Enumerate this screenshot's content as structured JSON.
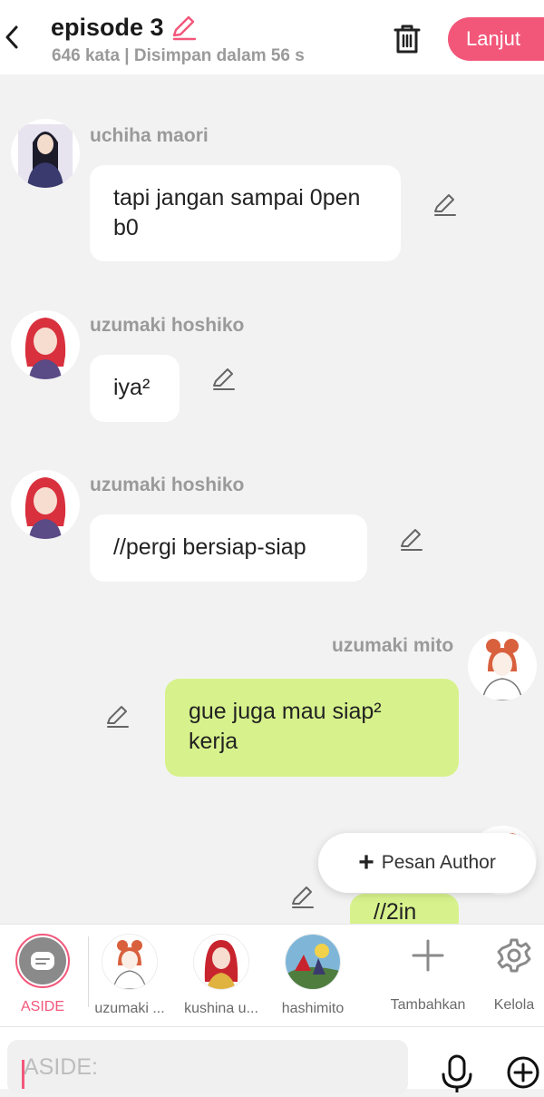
{
  "header": {
    "title": "episode 3",
    "subtitle": "646 kata | Disimpan dalam 56 s",
    "next_label": "Lanjut"
  },
  "messages": [
    {
      "sender": "uchiha maori",
      "text": "tapi jangan sampai 0pen b0",
      "side": "left"
    },
    {
      "sender": "uzumaki hoshiko",
      "text": "iya²",
      "side": "left"
    },
    {
      "sender": "uzumaki hoshiko",
      "text": "//pergi bersiap-siap",
      "side": "left"
    },
    {
      "sender": "uzumaki mito",
      "text": "gue juga mau siap² kerja",
      "side": "right"
    },
    {
      "sender": "",
      "text": "//2in",
      "side": "right"
    }
  ],
  "fab": {
    "label": "Pesan Author"
  },
  "characters": [
    {
      "label": "ASIDE"
    },
    {
      "label": "uzumaki ..."
    },
    {
      "label": "kushina u..."
    },
    {
      "label": "hashimito"
    },
    {
      "label": "Tambahkan"
    },
    {
      "label": "Kelola"
    }
  ],
  "input": {
    "placeholder": "ASIDE:"
  },
  "colors": {
    "accent": "#f2577a",
    "bubble_green": "#d7f28c",
    "bubble_white": "#ffffff",
    "background": "#f2f2f2"
  },
  "icons": [
    "back-arrow-icon",
    "pencil-icon",
    "trash-icon",
    "plus-icon",
    "gear-icon",
    "mic-icon",
    "add-circle-icon",
    "message-icon"
  ]
}
